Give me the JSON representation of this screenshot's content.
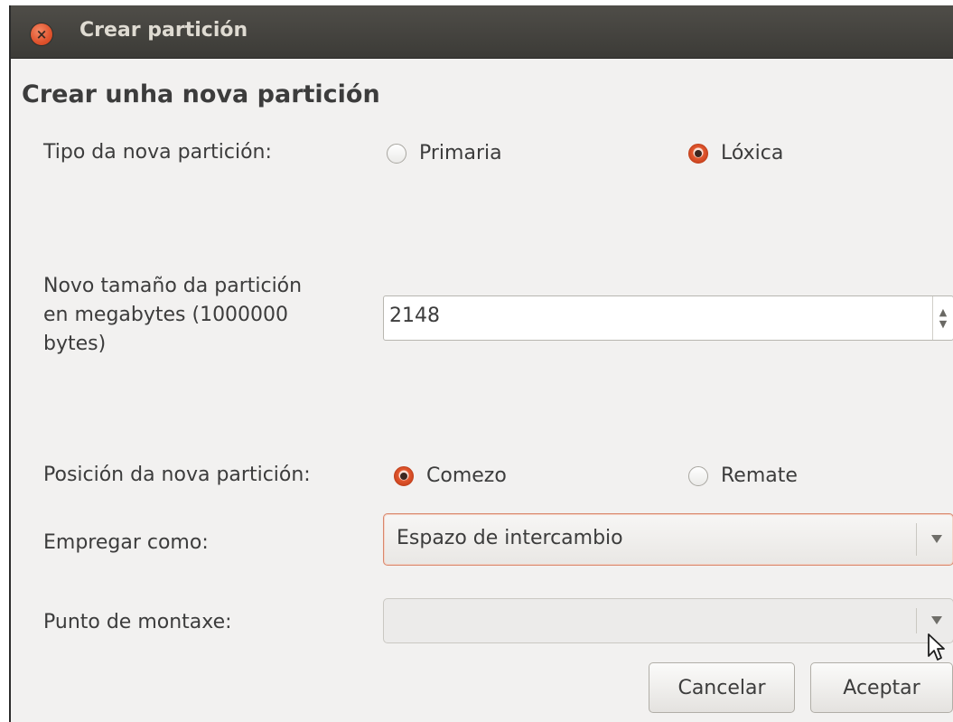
{
  "window": {
    "title": "Crear partición"
  },
  "dialog": {
    "heading": "Crear unha nova partición",
    "partition_type": {
      "label": "Tipo da nova partición:",
      "options": [
        {
          "label": "Primaria",
          "selected": false
        },
        {
          "label": "Lóxica",
          "selected": true
        }
      ]
    },
    "size": {
      "label_line1": "Novo tamaño da partición",
      "label_line2": "en megabytes (1000000",
      "label_line3": "bytes)",
      "value": "2148"
    },
    "position": {
      "label": "Posición da nova partición:",
      "options": [
        {
          "label": "Comezo",
          "selected": true
        },
        {
          "label": "Remate",
          "selected": false
        }
      ]
    },
    "use_as": {
      "label": "Empregar como:",
      "value": "Espazo de intercambio"
    },
    "mount_point": {
      "label": "Punto de montaxe:",
      "value": ""
    },
    "buttons": {
      "cancel": "Cancelar",
      "accept": "Aceptar"
    }
  },
  "icons": {
    "close": "close-icon",
    "spin_arrows": "spin-arrows-icon",
    "dropdown": "chevron-down-icon",
    "cursor": "mouse-cursor-icon"
  },
  "colors": {
    "titlebar": "#3c3b37",
    "accent": "#e0532d",
    "background": "#f2f1f0"
  }
}
